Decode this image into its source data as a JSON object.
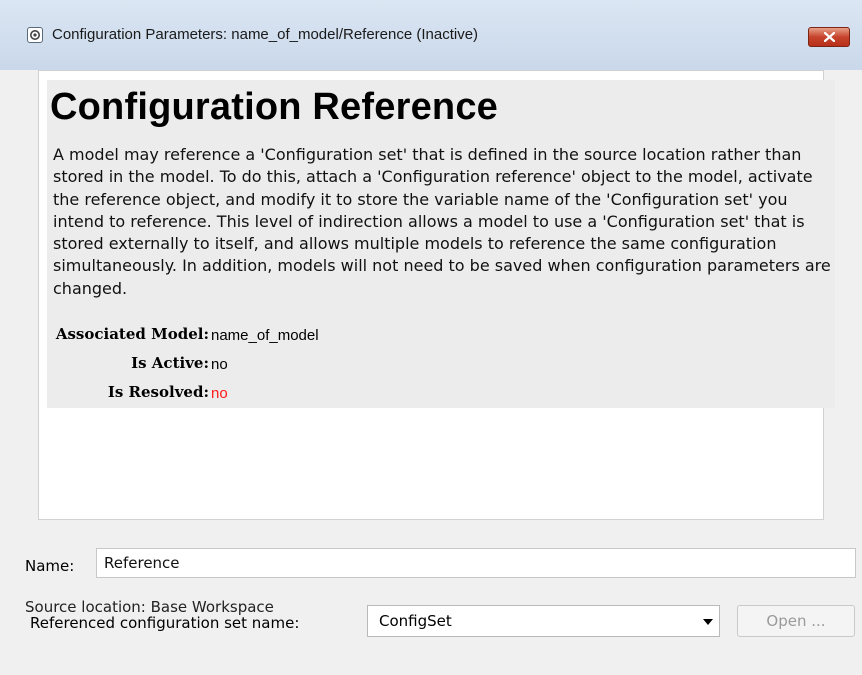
{
  "window": {
    "title": "Configuration Parameters: name_of_model/Reference (Inactive)",
    "icon": "gear-icon",
    "close_icon": "close-icon"
  },
  "panel": {
    "heading": "Configuration Reference",
    "description": "A model may reference a 'Configuration set' that is defined in the source location rather than stored in the model. To do this, attach a 'Configuration reference' object to the model, activate the reference object, and modify it to store the variable name of the 'Configuration set' you intend to reference. This level of indirection allows a model to use a 'Configuration set' that is stored externally to itself, and allows multiple models to reference the same configuration simultaneously. In addition, models will not need to be saved when configuration parameters are changed.",
    "properties": [
      {
        "label": "Associated Model:",
        "value": "name_of_model",
        "color": "#000000"
      },
      {
        "label": "Is Active:",
        "value": "no",
        "color": "#000000"
      },
      {
        "label": "Is Resolved:",
        "value": "no",
        "color": "#ff1a1a"
      }
    ]
  },
  "form": {
    "name_label": "Name:",
    "name_value": "Reference",
    "source_location": "Source location: Base Workspace",
    "ref_label": "Referenced configuration set name:",
    "ref_selected": "ConfigSet",
    "open_label": "Open ..."
  }
}
